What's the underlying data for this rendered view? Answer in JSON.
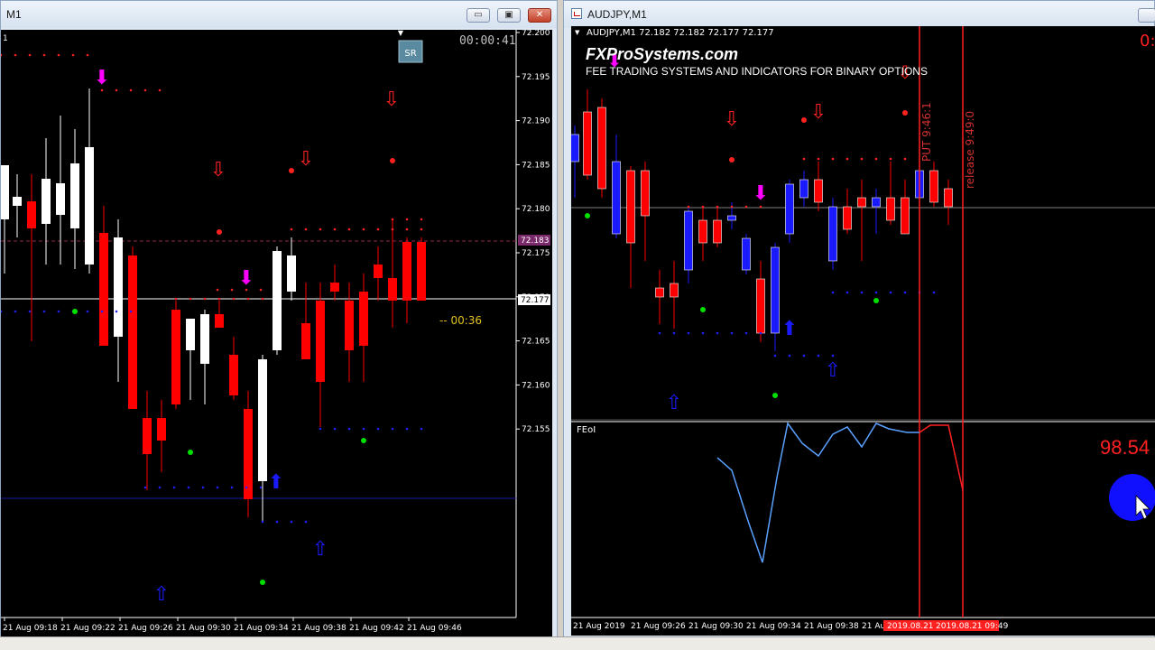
{
  "left_window": {
    "title": "M1",
    "buttons": {
      "minimize": "▭",
      "restore": "▣",
      "close": "✕"
    },
    "corner_label": "1",
    "timer": "00:00:41",
    "sr_button": "SR",
    "bar_timer": "-- 00:36",
    "price_scale": [
      "72.200",
      "72.195",
      "72.190",
      "72.185",
      "72.180",
      "72.175",
      "72.170",
      "72.165",
      "72.160",
      "72.155"
    ],
    "current_price": "72.177",
    "line_price": "72.183",
    "time_axis": [
      "21 Aug 09:18",
      "21 Aug 09:22",
      "21 Aug 09:26",
      "21 Aug 09:30",
      "21 Aug 09:34",
      "21 Aug 09:38",
      "21 Aug 09:42",
      "21 Aug 09:46"
    ]
  },
  "right_window": {
    "title": "AUDJPY,M1",
    "symbol_line": "AUDJPY,M1  72.182 72.182 72.177 72.177",
    "brand": "FXProSystems.com",
    "tagline": "FEE TRADING SYSTEMS AND INDICATORS FOR BINARY OPTIONS",
    "corner_value": "0:",
    "vertical_label_1": "PUT 9:46:1",
    "vertical_label_2": "release 9:49:0",
    "sub_indicator": "FEoI",
    "sub_value": "98.54",
    "time_axis": [
      "21 Aug 2019",
      "21 Aug 09:26",
      "21 Aug 09:30",
      "21 Aug 09:34",
      "21 Aug 09:38",
      "21 Au"
    ],
    "time_axis_highlight": [
      "2019.08.21",
      "2019.08.21 09:49"
    ]
  },
  "colors": {
    "bull": "#ffffff",
    "bear": "#ff0000",
    "bull_right": "#1a1aff",
    "dots_red": "#ff2020",
    "dots_blue": "#2020ff",
    "magenta": "#ff00ff",
    "green": "#00e000",
    "indicator": "#5aa0ff"
  },
  "icons": [
    "down-arrow-icon",
    "up-arrow-icon",
    "cursor-icon"
  ]
}
